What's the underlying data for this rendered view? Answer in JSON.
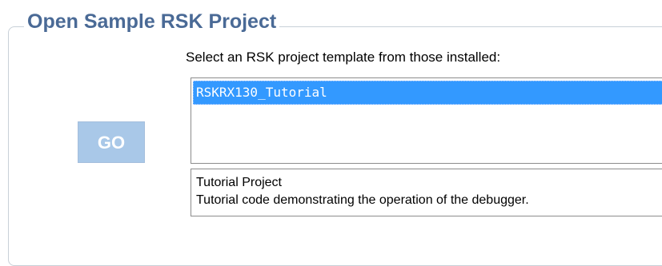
{
  "group": {
    "title": "Open Sample RSK Project"
  },
  "instruction": "Select an RSK project template from those installed:",
  "templates": [
    {
      "label": "RSKRX130_Tutorial",
      "selected": true
    }
  ],
  "description": {
    "line1": "Tutorial Project",
    "line2": "Tutorial code demonstrating the operation of the debugger."
  },
  "go_button": {
    "label": "GO",
    "state": "disabled"
  },
  "colors": {
    "title": "#4a6a96",
    "selection": "#3399ff",
    "go_button_bg": "#a9c8e8"
  }
}
